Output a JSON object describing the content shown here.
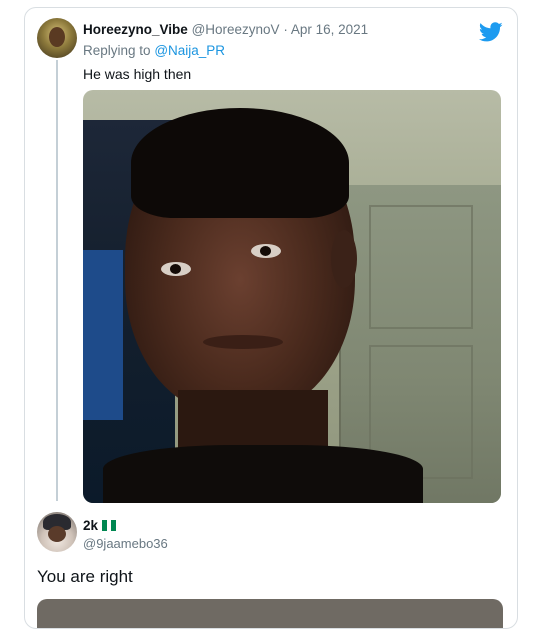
{
  "tweet": {
    "display_name": "Horeezyno_Vibe",
    "handle": "@HoreezynoV",
    "separator": "·",
    "date": "Apr 16, 2021",
    "replying_prefix": "Replying to",
    "replying_to": "@Naija_PR",
    "text": "He was high then"
  },
  "reply": {
    "display_name": "2k",
    "handle": "@9jaamebo36",
    "text": "You are right",
    "flag_colors": [
      "#008751",
      "#ffffff",
      "#008751"
    ]
  },
  "brand": {
    "icon": "twitter-bird-icon",
    "color": "#1d9bf0"
  }
}
